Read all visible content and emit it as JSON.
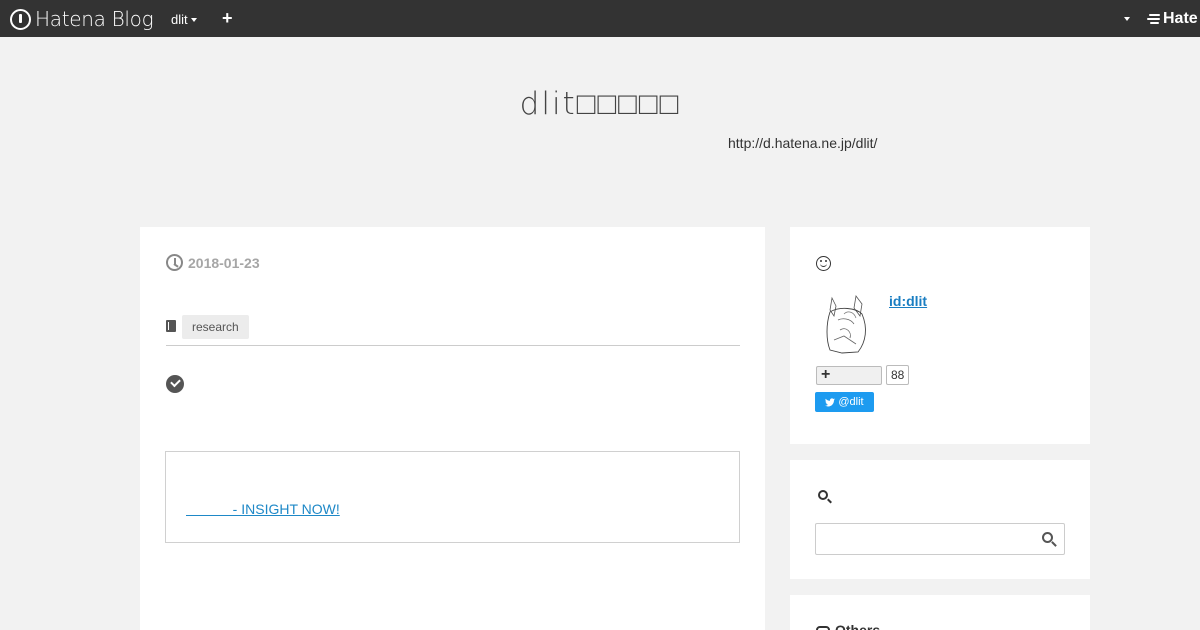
{
  "topbar": {
    "brand": "Hatena Blog",
    "user": "dlit",
    "add_label": "+",
    "right_brand": "Hate"
  },
  "header": {
    "title": "dlit□□□□□",
    "description": "http://d.hatena.ne.jp/dlit/"
  },
  "entry": {
    "date": "2018-01-23",
    "category": "research",
    "link_text": "            - INSIGHT NOW!"
  },
  "profile": {
    "user_id": "id:dlit",
    "subscribe_count": "88",
    "twitter_label": "@dlit"
  },
  "search": {
    "placeholder": ""
  },
  "others": {
    "title": "Others"
  },
  "colors": {
    "topbar": "#333333",
    "link": "#1e88c7",
    "twitter": "#1d9bf0",
    "background": "#f2f2f2"
  }
}
